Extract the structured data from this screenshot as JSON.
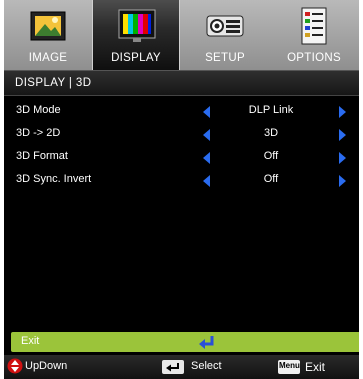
{
  "tabs": [
    {
      "label": "IMAGE",
      "icon": "image-icon",
      "selected": false
    },
    {
      "label": "DISPLAY",
      "icon": "display-icon",
      "selected": true
    },
    {
      "label": "SETUP",
      "icon": "projector-icon",
      "selected": false
    },
    {
      "label": "OPTIONS",
      "icon": "options-icon",
      "selected": false
    }
  ],
  "breadcrumb": "DISPLAY | 3D",
  "rows": [
    {
      "label": "3D Mode",
      "value": "DLP Link"
    },
    {
      "label": "3D -> 2D",
      "value": "3D"
    },
    {
      "label": "3D Format",
      "value": "Off"
    },
    {
      "label": "3D Sync. Invert",
      "value": "Off"
    }
  ],
  "exit_label": "Exit",
  "footer": {
    "updown": "UpDown",
    "select": "Select",
    "menu_key": "Menu",
    "exit": "Exit"
  },
  "colors": {
    "accent_blue": "#2a6cf0",
    "exit_green": "#9bc43a",
    "background": "#000000"
  }
}
